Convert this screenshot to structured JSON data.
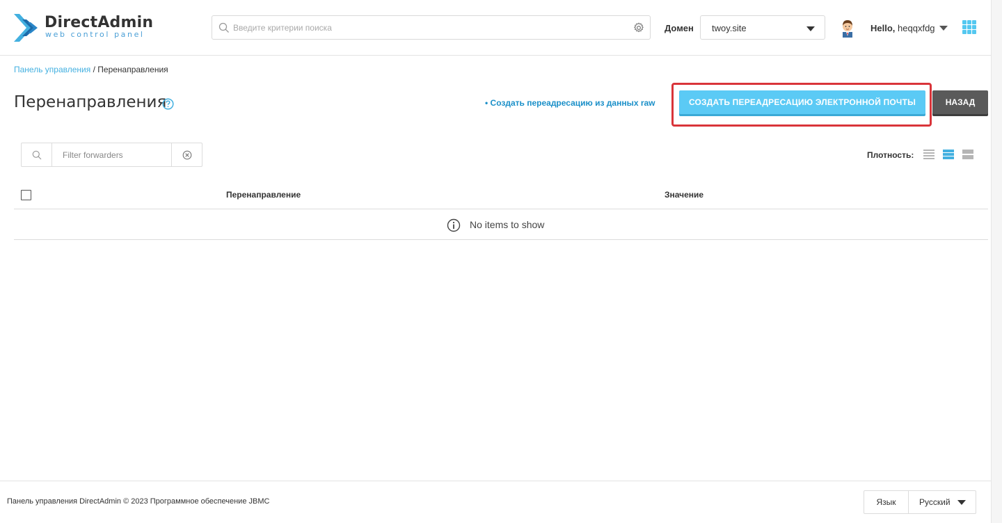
{
  "brand": {
    "title": "DirectAdmin",
    "subtitle": "web control panel",
    "accent": "#43b0e0"
  },
  "header": {
    "search_placeholder": "Введите критерии поиска",
    "domain_label": "Домен",
    "domain_value": "twoy.site",
    "hello_prefix": "Hello,",
    "username": "heqqxfdg"
  },
  "breadcrumb": {
    "root": "Панель управления",
    "separator": " / ",
    "current": "Перенаправления"
  },
  "page": {
    "title": "Перенаправления",
    "raw_link": "• Создать переадресацию из данных raw",
    "create_button": "СОЗДАТЬ ПЕРЕАДРЕСАЦИЮ ЭЛЕКТРОННОЙ ПОЧТЫ",
    "back_button": "НАЗАД"
  },
  "filter": {
    "placeholder": "Filter forwarders"
  },
  "density": {
    "label": "Плотность:",
    "selected": "medium"
  },
  "table": {
    "columns": [
      "Перенаправление",
      "Значение"
    ],
    "empty_text": "No items to show"
  },
  "footer": {
    "copyright": "Панель управления DirectAdmin © 2023 Программное обеспечение JBMC",
    "language_label": "Язык",
    "language_value": "Русский"
  },
  "colors": {
    "primary_button": "#5bcaf5",
    "secondary_button": "#5a5a5a",
    "highlight_border": "#d9343a",
    "link": "#1a8fc8"
  }
}
